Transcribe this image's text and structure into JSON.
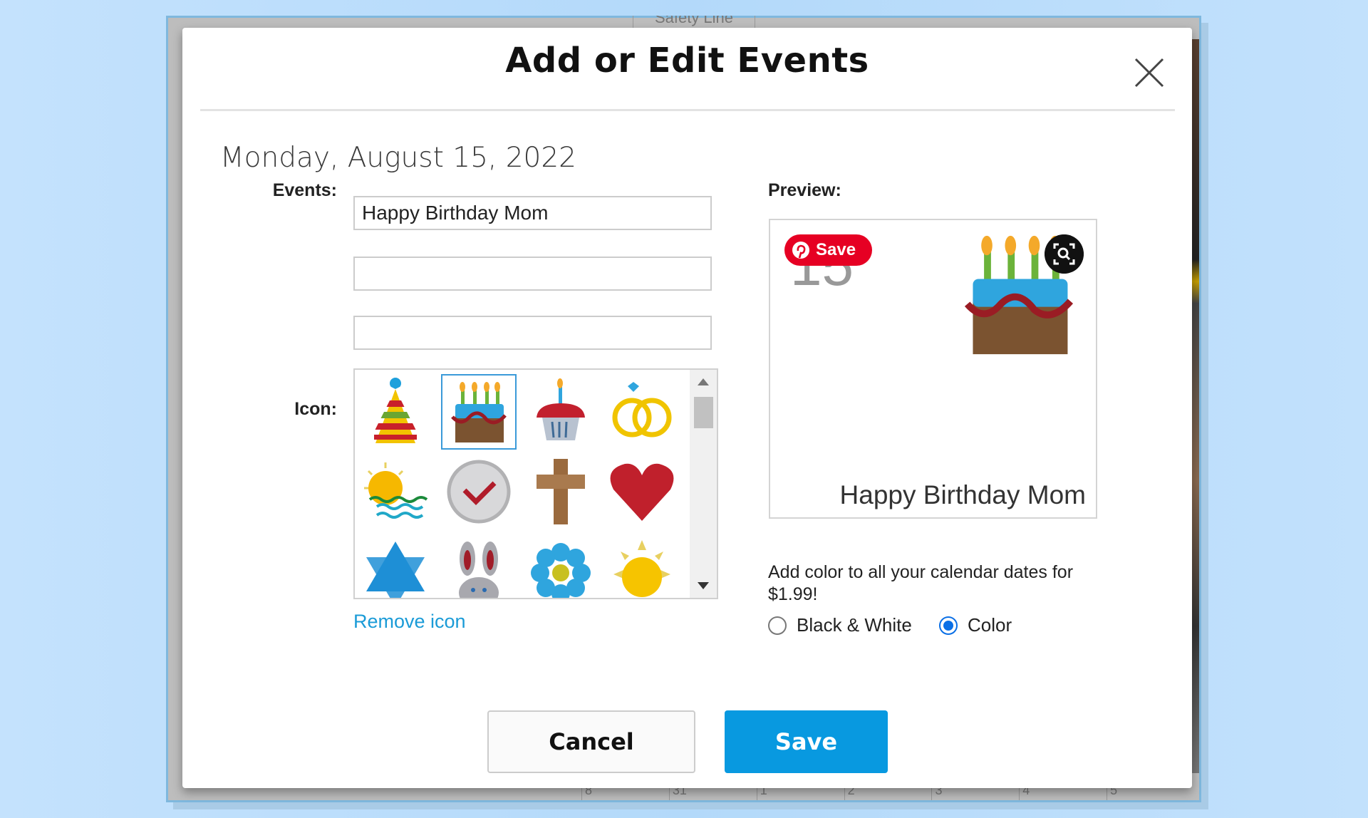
{
  "background": {
    "tab_label": "Safety Line",
    "calendar_numbers": [
      "8",
      "31",
      "1",
      "2",
      "3",
      "4",
      "5"
    ]
  },
  "modal": {
    "title": "Add or Edit Events",
    "date": "Monday, August 15, 2022",
    "events_label": "Events:",
    "events": [
      "Happy Birthday Mom",
      "",
      ""
    ],
    "icon_label": "Icon:",
    "icons": [
      "party-hat",
      "birthday-cake",
      "cupcake",
      "wedding-rings",
      "sunset-waves",
      "check-circle",
      "cross",
      "heart",
      "star-of-david",
      "bunny",
      "flower",
      "sun"
    ],
    "selected_icon": "birthday-cake",
    "remove_icon_label": "Remove icon",
    "preview_label": "Preview:",
    "preview": {
      "day_number": "15",
      "pin_save_label": "Save",
      "event_text": "Happy Birthday Mom"
    },
    "upsell_text": "Add color to all your calendar dates for $1.99!",
    "color_options": [
      {
        "label": "Black & White",
        "selected": false
      },
      {
        "label": "Color",
        "selected": true
      }
    ],
    "cancel_label": "Cancel",
    "save_label": "Save",
    "colors": {
      "accent": "#0899e0",
      "link": "#1a9bd7",
      "pinterest": "#e60023"
    }
  }
}
